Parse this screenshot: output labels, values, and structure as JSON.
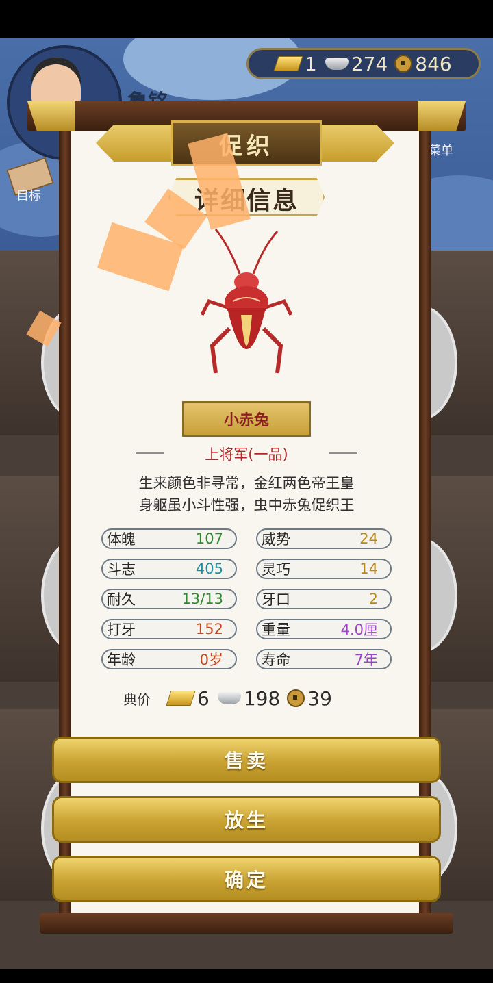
{
  "player": {
    "name": "鲁铭"
  },
  "currency": {
    "gold": "1",
    "silver": "274",
    "coin": "846"
  },
  "hud": {
    "target_label": "目标",
    "menu_label": "菜单"
  },
  "panel": {
    "title": "促织",
    "subtitle": "详细信息",
    "insect_name": "小赤兔",
    "rank": "上将军(一品)",
    "description": [
      "生来颜色非寻常，金红两色帝王皇",
      "身躯虽小斗性强，虫中赤兔促织王"
    ],
    "stats": [
      {
        "label": "体魄",
        "value": "107",
        "color": "#2f8a2f"
      },
      {
        "label": "威势",
        "value": "24",
        "color": "#b8861b"
      },
      {
        "label": "斗志",
        "value": "405",
        "color": "#1f8fa5"
      },
      {
        "label": "灵巧",
        "value": "14",
        "color": "#b8861b"
      },
      {
        "label": "耐久",
        "value": "13/13",
        "color": "#2f8a2f"
      },
      {
        "label": "牙口",
        "value": "2",
        "color": "#b8861b"
      },
      {
        "label": "打牙",
        "value": "152",
        "color": "#c4481f"
      },
      {
        "label": "重量",
        "value": "4.0厘",
        "color": "#9a45c4"
      },
      {
        "label": "年龄",
        "value": "0岁",
        "color": "#c4481f"
      },
      {
        "label": "寿命",
        "value": "7年",
        "color": "#9a45c4"
      }
    ],
    "price_label": "典价",
    "price": {
      "gold": "6",
      "silver": "198",
      "coin": "39"
    }
  },
  "buttons": {
    "sell": "售卖",
    "release": "放生",
    "confirm": "确定"
  }
}
